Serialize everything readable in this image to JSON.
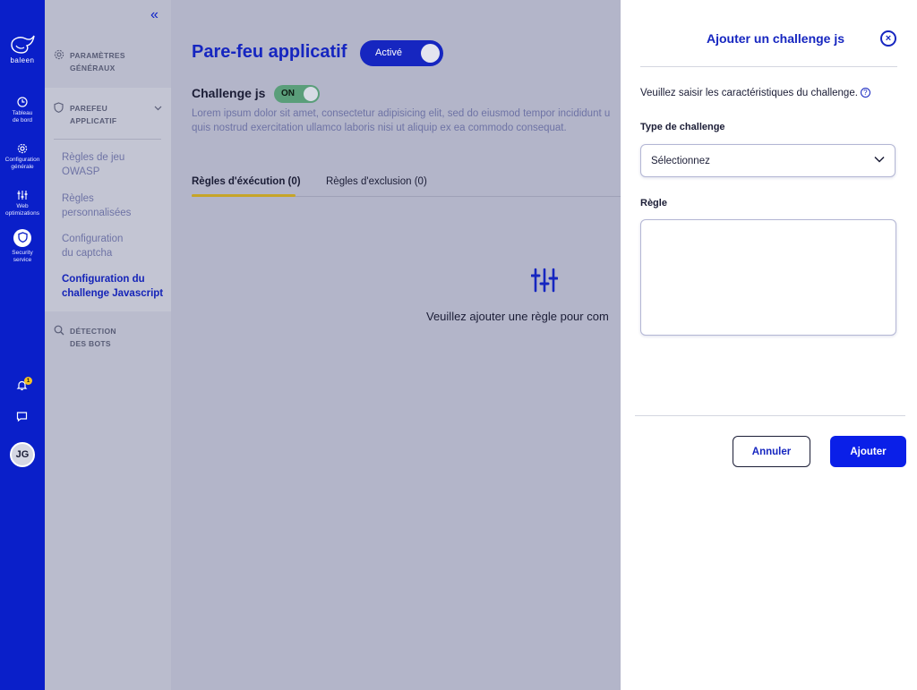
{
  "brand": {
    "name": "baleen",
    "accent": "#0a1fc9"
  },
  "rail": {
    "items": [
      {
        "label_line1": "Tableau",
        "label_line2": "de bord",
        "icon": "clock-icon"
      },
      {
        "label_line1": "Configuration",
        "label_line2": "générale",
        "icon": "gear-icon"
      },
      {
        "label_line1": "Web",
        "label_line2": "optimizations",
        "icon": "sliders-icon"
      },
      {
        "label_line1": "Security",
        "label_line2": "service",
        "icon": "shield-icon"
      }
    ],
    "notifications_count": "1",
    "user_initials": "JG"
  },
  "subnav": {
    "sections": [
      {
        "line1": "PARAMÈTRES",
        "line2": "GÉNÉRAUX",
        "icon": "gear-icon"
      },
      {
        "line1": "PAREFEU",
        "line2": "APPLICATIF",
        "icon": "shield-icon"
      },
      {
        "line1": "DÉTECTION",
        "line2": "DES BOTS",
        "icon": "search-icon"
      }
    ],
    "links": [
      {
        "line1": "Règles de jeu",
        "line2": "OWASP"
      },
      {
        "line1": "Règles",
        "line2": "personnalisées"
      },
      {
        "line1": "Configuration",
        "line2": "du captcha"
      },
      {
        "line1": "Configuration du",
        "line2": "challenge Javascript"
      }
    ]
  },
  "main": {
    "title": "Pare-feu applicatif",
    "toggle_label": "Activé",
    "subtitle": "Challenge js",
    "sub_toggle_label": "ON",
    "desc_line1": "Lorem ipsum dolor sit amet, consectetur adipisicing elit, sed do eiusmod tempor incididunt u",
    "desc_line2": "quis nostrud exercitation ullamco laboris nisi ut aliquip ex ea commodo consequat.",
    "tabs": [
      {
        "label": "Règles d'éxécution (0)"
      },
      {
        "label": "Règles d'exclusion (0)"
      }
    ],
    "empty_text": "Veuillez ajouter une règle pour com"
  },
  "panel": {
    "title": "Ajouter un challenge js",
    "intro": "Veuillez saisir les caractéristiques du challenge.",
    "type_label": "Type de challenge",
    "type_value": "Sélectionnez",
    "rule_label": "Règle",
    "rule_value": "",
    "cancel_label": "Annuler",
    "add_label": "Ajouter"
  }
}
